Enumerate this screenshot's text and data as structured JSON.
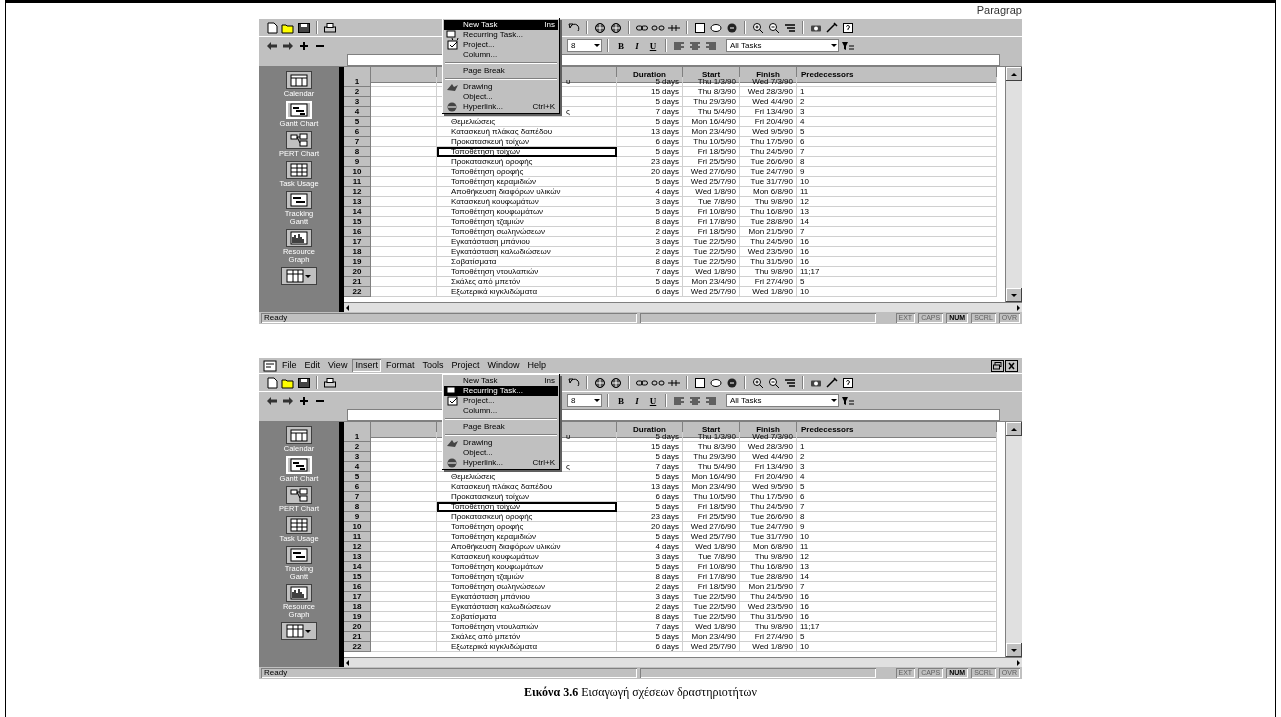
{
  "page_heading": "Paragrap",
  "screenshots": [
    {
      "toolbar": {
        "font_size": "8",
        "format_buttons": [
          "B",
          "I",
          "U"
        ],
        "filter": "All Tasks"
      },
      "view_bar": [
        {
          "label": "Calendar",
          "selected": false
        },
        {
          "label": "Gantt Chart",
          "selected": true
        },
        {
          "label": "PERT Chart",
          "selected": false
        },
        {
          "label": "Task Usage",
          "selected": false
        },
        {
          "label": "Tracking Gantt",
          "selected": false
        },
        {
          "label": "Resource Graph",
          "selected": false
        }
      ],
      "table": {
        "columns": [
          "Duration",
          "Start",
          "Finish",
          "Predecessors"
        ],
        "rows": [
          {
            "id": "1",
            "name": "υ",
            "duration": "5 days",
            "start": "Thu 1/3/90",
            "finish": "Wed 7/3/90",
            "selected": false
          },
          {
            "id": "2",
            "duration": "15 days",
            "start": "Thu 8/3/90",
            "finish": "Wed 28/3/90",
            "predecessors": "1",
            "selected": false
          },
          {
            "id": "3",
            "duration": "5 days",
            "start": "Thu 29/3/90",
            "finish": "Wed 4/4/90",
            "predecessors": "2",
            "selected": false
          },
          {
            "id": "4",
            "name": "ς",
            "duration": "7 days",
            "start": "Thu 5/4/90",
            "finish": "Fri 13/4/90",
            "predecessors": "3",
            "selected": false
          },
          {
            "id": "5",
            "name": "Θεμελιώσεις",
            "duration": "5 days",
            "start": "Mon 16/4/90",
            "finish": "Fri 20/4/90",
            "predecessors": "4",
            "selected": false
          },
          {
            "id": "6",
            "name": "Κατασκευή πλάκας δαπέδου",
            "duration": "13 days",
            "start": "Mon 23/4/90",
            "finish": "Wed 9/5/90",
            "predecessors": "5",
            "selected": false
          },
          {
            "id": "7",
            "name": "Προκατασκευή τοίχων",
            "duration": "6 days",
            "start": "Thu 10/5/90",
            "finish": "Thu 17/5/90",
            "predecessors": "6",
            "selected": false
          },
          {
            "id": "8",
            "name": "Τοποθέτηση τοίχων",
            "duration": "5 days",
            "start": "Fri 18/5/90",
            "finish": "Thu 24/5/90",
            "predecessors": "7",
            "selected": true
          },
          {
            "id": "9",
            "name": "Προκατασκευή οροφής",
            "duration": "23 days",
            "start": "Fri 25/5/90",
            "finish": "Tue 26/6/90",
            "predecessors": "8",
            "selected": false
          },
          {
            "id": "10",
            "name": "Τοποθέτηση οροφής",
            "duration": "20 days",
            "start": "Wed 27/6/90",
            "finish": "Tue 24/7/90",
            "predecessors": "9",
            "selected": false
          },
          {
            "id": "11",
            "name": "Τοποθέτηση κεραμιδιών",
            "duration": "5 days",
            "start": "Wed 25/7/90",
            "finish": "Tue 31/7/90",
            "predecessors": "10",
            "selected": false
          },
          {
            "id": "12",
            "name": "Αποθήκευση διαφόρων υλικών",
            "duration": "4 days",
            "start": "Wed 1/8/90",
            "finish": "Mon 6/8/90",
            "predecessors": "11",
            "selected": false
          },
          {
            "id": "13",
            "name": "Κατασκευή κουφωμάτων",
            "duration": "3 days",
            "start": "Tue 7/8/90",
            "finish": "Thu 9/8/90",
            "predecessors": "12",
            "selected": false
          },
          {
            "id": "14",
            "name": "Τοποθέτηση κουφωμάτων",
            "duration": "5 days",
            "start": "Fri 10/8/90",
            "finish": "Thu 16/8/90",
            "predecessors": "13",
            "selected": false
          },
          {
            "id": "15",
            "name": "Τοποθέτηση τζαμιών",
            "duration": "8 days",
            "start": "Fri 17/8/90",
            "finish": "Tue 28/8/90",
            "predecessors": "14",
            "selected": false
          },
          {
            "id": "16",
            "name": "Τοποθέτηση σωληνώσεων",
            "duration": "2 days",
            "start": "Fri 18/5/90",
            "finish": "Mon 21/5/90",
            "predecessors": "7",
            "selected": false
          },
          {
            "id": "17",
            "name": "Εγκατάσταση μπάνιου",
            "duration": "3 days",
            "start": "Tue 22/5/90",
            "finish": "Thu 24/5/90",
            "predecessors": "16",
            "selected": false
          },
          {
            "id": "18",
            "name": "Εγκατάσταση καλωδιώσεων",
            "duration": "2 days",
            "start": "Tue 22/5/90",
            "finish": "Wed 23/5/90",
            "predecessors": "16",
            "selected": false
          },
          {
            "id": "19",
            "name": "Σοβατίσματα",
            "duration": "8 days",
            "start": "Tue 22/5/90",
            "finish": "Thu 31/5/90",
            "predecessors": "16",
            "selected": false
          },
          {
            "id": "20",
            "name": "Τοποθέτηση ντουλαπιών",
            "duration": "7 days",
            "start": "Wed 1/8/90",
            "finish": "Thu 9/8/90",
            "predecessors": "11;17",
            "selected": false
          },
          {
            "id": "21",
            "name": "Σκάλες από μπετόν",
            "duration": "5 days",
            "start": "Mon 23/4/90",
            "finish": "Fri 27/4/90",
            "predecessors": "5",
            "selected": false
          },
          {
            "id": "22",
            "name": "Εξωτερικά κιγκλιδώματα",
            "duration": "6 days",
            "start": "Wed 25/7/90",
            "finish": "Wed 1/8/90",
            "predecessors": "10",
            "selected": false
          }
        ]
      },
      "insert_menu": [
        {
          "kind": "item",
          "label": "New Task",
          "shortcut": "Ins",
          "selected": true
        },
        {
          "kind": "item",
          "label": "Recurring Task...",
          "selected": false
        },
        {
          "kind": "item",
          "label": "Project...",
          "selected": false
        },
        {
          "kind": "item",
          "label": "Column...",
          "selected": false
        },
        {
          "kind": "separator"
        },
        {
          "kind": "item",
          "label": "Page Break",
          "selected": false
        },
        {
          "kind": "separator"
        },
        {
          "kind": "item",
          "label": "Drawing",
          "selected": false
        },
        {
          "kind": "item",
          "label": "Object...",
          "selected": false
        },
        {
          "kind": "item",
          "label": "Hyperlink...",
          "shortcut": "Ctrl+K",
          "selected": false
        }
      ],
      "status_bar": {
        "text": "Ready",
        "indicators": [
          {
            "label": "EXT",
            "on": false
          },
          {
            "label": "CAPS",
            "on": false
          },
          {
            "label": "NUM",
            "on": true
          },
          {
            "label": "SCRL",
            "on": false
          },
          {
            "label": "OVR",
            "on": false
          }
        ]
      }
    },
    {
      "menu_bar": [
        {
          "label": "File",
          "selected": false
        },
        {
          "label": "Edit",
          "selected": false
        },
        {
          "label": "View",
          "selected": false
        },
        {
          "label": "Insert",
          "selected": true
        },
        {
          "label": "Format",
          "selected": false
        },
        {
          "label": "Tools",
          "selected": false
        },
        {
          "label": "Project",
          "selected": false
        },
        {
          "label": "Window",
          "selected": false
        },
        {
          "label": "Help",
          "selected": false
        }
      ],
      "toolbar": {
        "font_size": "8",
        "format_buttons": [
          "B",
          "I",
          "U"
        ],
        "filter": "All Tasks"
      },
      "view_bar": [
        {
          "label": "Calendar",
          "selected": false
        },
        {
          "label": "Gantt Chart",
          "selected": true
        },
        {
          "label": "PERT Chart",
          "selected": false
        },
        {
          "label": "Task Usage",
          "selected": false
        },
        {
          "label": "Tracking Gantt",
          "selected": false
        },
        {
          "label": "Resource Graph",
          "selected": false
        }
      ],
      "table": {
        "columns": [
          "Duration",
          "Start",
          "Finish",
          "Predecessors"
        ],
        "rows": [
          {
            "id": "1",
            "name": "υ",
            "duration": "5 days",
            "start": "Thu 1/3/90",
            "finish": "Wed 7/3/90",
            "selected": false
          },
          {
            "id": "2",
            "duration": "15 days",
            "start": "Thu 8/3/90",
            "finish": "Wed 28/3/90",
            "predecessors": "1",
            "selected": false
          },
          {
            "id": "3",
            "duration": "5 days",
            "start": "Thu 29/3/90",
            "finish": "Wed 4/4/90",
            "predecessors": "2",
            "selected": false
          },
          {
            "id": "4",
            "name": "ς",
            "duration": "7 days",
            "start": "Thu 5/4/90",
            "finish": "Fri 13/4/90",
            "predecessors": "3",
            "selected": false
          },
          {
            "id": "5",
            "name": "Θεμελιώσεις",
            "duration": "5 days",
            "start": "Mon 16/4/90",
            "finish": "Fri 20/4/90",
            "predecessors": "4",
            "selected": false
          },
          {
            "id": "6",
            "name": "Κατασκευή πλάκας δαπέδου",
            "duration": "13 days",
            "start": "Mon 23/4/90",
            "finish": "Wed 9/5/90",
            "predecessors": "5",
            "selected": false
          },
          {
            "id": "7",
            "name": "Προκατασκευή τοίχων",
            "duration": "6 days",
            "start": "Thu 10/5/90",
            "finish": "Thu 17/5/90",
            "predecessors": "6",
            "selected": false
          },
          {
            "id": "8",
            "name": "Τοποθέτηση τοίχων",
            "duration": "5 days",
            "start": "Fri 18/5/90",
            "finish": "Thu 24/5/90",
            "predecessors": "7",
            "selected": true
          },
          {
            "id": "9",
            "name": "Προκατασκευή οροφής",
            "duration": "23 days",
            "start": "Fri 25/5/90",
            "finish": "Tue 26/6/90",
            "predecessors": "8",
            "selected": false
          },
          {
            "id": "10",
            "name": "Τοποθέτηση οροφής",
            "duration": "20 days",
            "start": "Wed 27/6/90",
            "finish": "Tue 24/7/90",
            "predecessors": "9",
            "selected": false
          },
          {
            "id": "11",
            "name": "Τοποθέτηση κεραμιδιών",
            "duration": "5 days",
            "start": "Wed 25/7/90",
            "finish": "Tue 31/7/90",
            "predecessors": "10",
            "selected": false
          },
          {
            "id": "12",
            "name": "Αποθήκευση διαφόρων υλικών",
            "duration": "4 days",
            "start": "Wed 1/8/90",
            "finish": "Mon 6/8/90",
            "predecessors": "11",
            "selected": false
          },
          {
            "id": "13",
            "name": "Κατασκευή κουφωμάτων",
            "duration": "3 days",
            "start": "Tue 7/8/90",
            "finish": "Thu 9/8/90",
            "predecessors": "12",
            "selected": false
          },
          {
            "id": "14",
            "name": "Τοποθέτηση κουφωμάτων",
            "duration": "5 days",
            "start": "Fri 10/8/90",
            "finish": "Thu 16/8/90",
            "predecessors": "13",
            "selected": false
          },
          {
            "id": "15",
            "name": "Τοποθέτηση τζαμιών",
            "duration": "8 days",
            "start": "Fri 17/8/90",
            "finish": "Tue 28/8/90",
            "predecessors": "14",
            "selected": false
          },
          {
            "id": "16",
            "name": "Τοποθέτηση σωληνώσεων",
            "duration": "2 days",
            "start": "Fri 18/5/90",
            "finish": "Mon 21/5/90",
            "predecessors": "7",
            "selected": false
          },
          {
            "id": "17",
            "name": "Εγκατάσταση μπάνιου",
            "duration": "3 days",
            "start": "Tue 22/5/90",
            "finish": "Thu 24/5/90",
            "predecessors": "16",
            "selected": false
          },
          {
            "id": "18",
            "name": "Εγκατάσταση καλωδιώσεων",
            "duration": "2 days",
            "start": "Tue 22/5/90",
            "finish": "Wed 23/5/90",
            "predecessors": "16",
            "selected": false
          },
          {
            "id": "19",
            "name": "Σοβατίσματα",
            "duration": "8 days",
            "start": "Tue 22/5/90",
            "finish": "Thu 31/5/90",
            "predecessors": "16",
            "selected": false
          },
          {
            "id": "20",
            "name": "Τοποθέτηση ντουλαπιών",
            "duration": "7 days",
            "start": "Wed 1/8/90",
            "finish": "Thu 9/8/90",
            "predecessors": "11;17",
            "selected": false
          },
          {
            "id": "21",
            "name": "Σκάλες από μπετόν",
            "duration": "5 days",
            "start": "Mon 23/4/90",
            "finish": "Fri 27/4/90",
            "predecessors": "5",
            "selected": false
          },
          {
            "id": "22",
            "name": "Εξωτερικά κιγκλιδώματα",
            "duration": "6 days",
            "start": "Wed 25/7/90",
            "finish": "Wed 1/8/90",
            "predecessors": "10",
            "selected": false
          }
        ]
      },
      "insert_menu": [
        {
          "kind": "item",
          "label": "New Task",
          "shortcut": "Ins",
          "selected": false
        },
        {
          "kind": "item",
          "label": "Recurring Task...",
          "selected": true
        },
        {
          "kind": "item",
          "label": "Project...",
          "selected": false
        },
        {
          "kind": "item",
          "label": "Column...",
          "selected": false
        },
        {
          "kind": "separator"
        },
        {
          "kind": "item",
          "label": "Page Break",
          "selected": false
        },
        {
          "kind": "separator"
        },
        {
          "kind": "item",
          "label": "Drawing",
          "selected": false
        },
        {
          "kind": "item",
          "label": "Object...",
          "selected": false
        },
        {
          "kind": "item",
          "label": "Hyperlink...",
          "shortcut": "Ctrl+K",
          "selected": false
        }
      ],
      "status_bar": {
        "text": "Ready",
        "indicators": [
          {
            "label": "EXT",
            "on": false
          },
          {
            "label": "CAPS",
            "on": false
          },
          {
            "label": "NUM",
            "on": true
          },
          {
            "label": "SCRL",
            "on": false
          },
          {
            "label": "OVR",
            "on": false
          }
        ]
      }
    }
  ],
  "caption": "**Εικόνα 3.6** Εισαγωγή σχέσεων δραστηριοτήτων"
}
